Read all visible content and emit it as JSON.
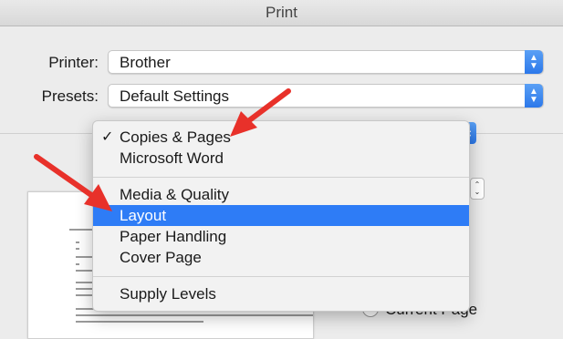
{
  "window": {
    "title": "Print"
  },
  "printer": {
    "label": "Printer:",
    "value": "Brother"
  },
  "presets": {
    "label": "Presets:",
    "value": "Default Settings"
  },
  "menu": {
    "items": [
      {
        "label": "Copies & Pages",
        "checked": true,
        "selected": false
      },
      {
        "label": "Microsoft Word",
        "checked": false,
        "selected": false
      },
      {
        "label": "Media & Quality",
        "checked": false,
        "selected": false
      },
      {
        "label": "Layout",
        "checked": false,
        "selected": true
      },
      {
        "label": "Paper Handling",
        "checked": false,
        "selected": false
      },
      {
        "label": "Cover Page",
        "checked": false,
        "selected": false
      },
      {
        "label": "Supply Levels",
        "checked": false,
        "selected": false
      }
    ],
    "check_glyph": "✓"
  },
  "pages": {
    "current_page_label": "Current Page"
  },
  "colors": {
    "accent": "#2e7cf6",
    "annotation_arrow": "#e8312a"
  },
  "icons": {
    "stepper": "up-down-chevrons-icon",
    "checkmark": "checkmark-icon",
    "radio": "radio-button-icon"
  }
}
